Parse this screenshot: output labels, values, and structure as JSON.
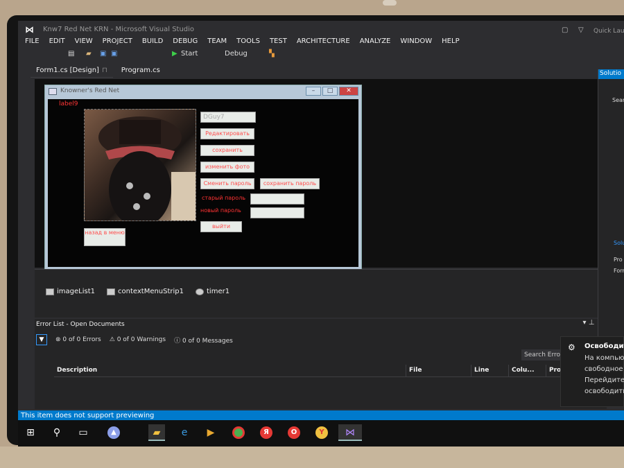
{
  "window": {
    "title": "Knw7 Red Net KRN - Microsoft Visual Studio",
    "quick_launch": "Quick Laun"
  },
  "menu": [
    "FILE",
    "EDIT",
    "VIEW",
    "PROJECT",
    "BUILD",
    "DEBUG",
    "TEAM",
    "TOOLS",
    "TEST",
    "ARCHITECTURE",
    "ANALYZE",
    "WINDOW",
    "HELP"
  ],
  "toolbar": {
    "start": "Start",
    "config": "Debug"
  },
  "tabs": [
    {
      "label": "Form1.cs [Design]"
    },
    {
      "label": "Program.cs"
    }
  ],
  "form": {
    "title": "Knowner's Red Net",
    "label9": "label9",
    "username_box": "DGuy7",
    "buttons": {
      "edit": "Редактировать",
      "save": "сохранить",
      "change_photo": "изменить фото",
      "change_password": "Сменить пароль",
      "save_password": "сохранить пароль",
      "logout": "выйти",
      "back": "назад в меню"
    },
    "labels": {
      "old_password": "старый пароль",
      "new_password": "новый пароль"
    }
  },
  "tray": {
    "items": [
      "imageList1",
      "contextMenuStrip1",
      "timer1"
    ]
  },
  "error_list": {
    "title": "Error List - Open Documents",
    "errors": "0 of 0 Errors",
    "warnings": "0 of 0 Warnings",
    "messages": "0 of 0 Messages",
    "search_placeholder": "Search Error List",
    "columns": [
      "Description",
      "File",
      "Line",
      "Colu...",
      "Pro"
    ]
  },
  "solution": {
    "title": "Solutio",
    "search": "Searc",
    "sol_label": "Solu",
    "pro": "Pro",
    "form": "Form"
  },
  "statusbar": {
    "text": "This item does not support previewing"
  },
  "toast": {
    "title": "Освободит",
    "lines": [
      "На компьют",
      "свободное",
      "Перейдите",
      "освободить"
    ]
  },
  "colors": {
    "accent": "#007acc",
    "form_text": "#ff4d4d",
    "bg": "#2d2d30"
  }
}
